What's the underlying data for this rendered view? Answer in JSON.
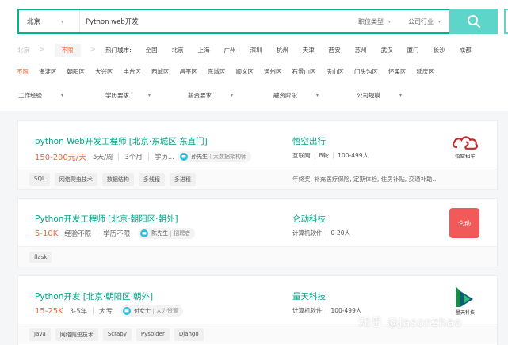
{
  "search": {
    "city": "北京",
    "query": "Python web开发",
    "job_type": "职位类型",
    "industry": "公司行业"
  },
  "city_row": {
    "current_city": "北京",
    "unlimited": "不限",
    "hot_label": "热门城市:",
    "cities": [
      "全国",
      "北京",
      "上海",
      "广州",
      "深圳",
      "杭州",
      "天津",
      "西安",
      "苏州",
      "武汉",
      "厦门",
      "长沙",
      "成都"
    ]
  },
  "district_row": {
    "items": [
      "不限",
      "海淀区",
      "朝阳区",
      "大兴区",
      "丰台区",
      "西城区",
      "昌平区",
      "东城区",
      "顺义区",
      "通州区",
      "石景山区",
      "房山区",
      "门头沟区",
      "怀柔区",
      "延庆区"
    ]
  },
  "filter_row": {
    "items": [
      "工作经验",
      "学历要求",
      "薪资要求",
      "融资阶段",
      "公司规模"
    ]
  },
  "jobs": [
    {
      "title": "python Web开发工程师  [北京·东城区·东直门]",
      "salary": "150-200元/天",
      "meta": [
        "5天/周",
        "3个月",
        "学历..."
      ],
      "recruiter": "孙先生",
      "recruiter_role": "大数据架构师",
      "company": "悟空出行",
      "company_meta": [
        "互联网",
        "B轮",
        "100-499人"
      ],
      "tags": [
        "SQL",
        "网络爬虫技术",
        "数据结构",
        "多线程",
        "多进程"
      ],
      "benefit": "年终奖, 补充医疗保险, 定期体检, 住房补贴, 交通补助...",
      "logo_text": "悟空租车",
      "logo_color": "#c4282a"
    },
    {
      "title": "Python开发工程师  [北京·朝阳区·朝外]",
      "salary": "5-10K",
      "meta": [
        "经验不限",
        "学历不限"
      ],
      "recruiter": "陈先生",
      "recruiter_role": "招聘者",
      "company": "仑动科技",
      "company_meta": [
        "计算机软件",
        "0-20人"
      ],
      "tags": [
        "flask"
      ],
      "benefit": "",
      "logo_text": "仑动",
      "logo_color": "#f25a5a"
    },
    {
      "title": "Python开发  [北京·朝阳区·朝外]",
      "salary": "15-25K",
      "meta": [
        "3-5年",
        "大专"
      ],
      "recruiter": "付女士",
      "recruiter_role": "人力资源",
      "company": "量天科技",
      "company_meta": [
        "计算机软件",
        "100-499人"
      ],
      "tags": [
        "Java",
        "网络爬虫技术",
        "Scrapy",
        "Pyspider",
        "Django"
      ],
      "benefit": "",
      "logo_text": "量天科技",
      "logo_color": "#1a8a4a"
    }
  ],
  "watermark": "知乎 @Jasonzhao",
  "colors": {
    "brand": "#00b38a",
    "accent": "#ff6a3d",
    "salary": "#fd5f39",
    "link": "#00a488"
  }
}
